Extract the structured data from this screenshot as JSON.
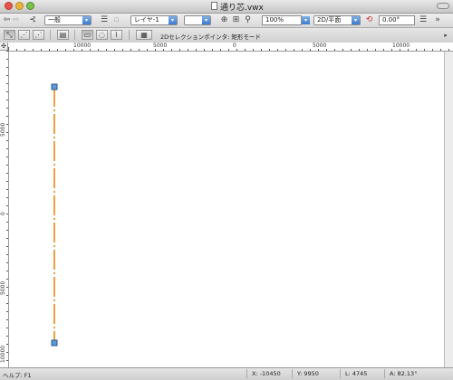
{
  "window": {
    "title": "通り芯.vwx"
  },
  "toolbar1": {
    "class_dropdown": "一般",
    "layer_dropdown": "レイヤ-1",
    "zoom_value": "100%",
    "view_dropdown": "2D/平面",
    "rotation_value": "0.00°"
  },
  "toolbar2": {
    "tool_hint": "2Dセレクションポインタ: 矩形モード"
  },
  "ruler_top": {
    "labels": [
      "10000",
      "5000",
      "0",
      "5000",
      "10000"
    ]
  },
  "ruler_left": {
    "labels": [
      "5000",
      "0",
      "5000",
      "10000"
    ]
  },
  "drawing": {
    "line_color": "#f0a040",
    "handle_color": "#5b9bd5"
  },
  "status": {
    "help": "ヘルプ: F1",
    "x": "X:  -10450",
    "y": "Y:  9950",
    "l": "L:  4745",
    "a": "A:  82.13°"
  }
}
